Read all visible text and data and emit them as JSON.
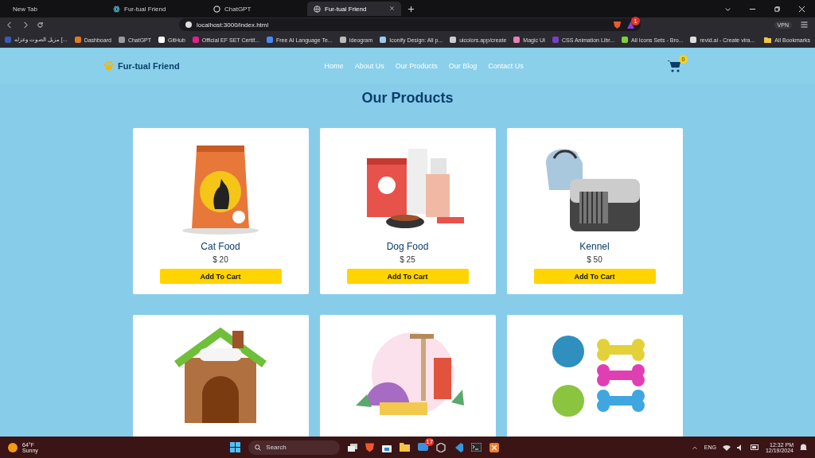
{
  "browser": {
    "tabs": [
      {
        "title": "New Tab",
        "selected": false
      },
      {
        "title": "Fur-tual Friend",
        "selected": false
      },
      {
        "title": "ChatGPT",
        "selected": false
      },
      {
        "title": "Fur-tual Friend",
        "selected": true
      }
    ],
    "address": "localhost:3000/index.html",
    "alert_count": "1",
    "vpn": "VPN",
    "bookmarks": [
      {
        "label": "مزيل الصوت وعزله [...",
        "color": "#3b5bb5"
      },
      {
        "label": "Dashboard",
        "color": "#e07a1f"
      },
      {
        "label": "ChatGPT",
        "color": "#9a9a9a"
      },
      {
        "label": "GitHub",
        "color": "#ffffff"
      },
      {
        "label": "Official EF SET Certif...",
        "color": "#e0218a"
      },
      {
        "label": "Free AI Language Te...",
        "color": "#4a8af4"
      },
      {
        "label": "Ideogram",
        "color": "#bbbbbb"
      },
      {
        "label": "Iconify Design: All p...",
        "color": "#9ec9ef"
      },
      {
        "label": "uicolors.app/create",
        "color": "#cccccc"
      },
      {
        "label": "Magic UI",
        "color": "#e87fb8"
      },
      {
        "label": "CSS Animation Libr...",
        "color": "#7a3fc2"
      },
      {
        "label": "All Icons Sets - Bro...",
        "color": "#7bd13b"
      },
      {
        "label": "revid.ai - Create vira...",
        "color": "#dddddd"
      }
    ],
    "all_bookmarks": "All Bookmarks"
  },
  "site": {
    "logo": "Fur-tual Friend",
    "nav": [
      {
        "label": "Home"
      },
      {
        "label": "About Us"
      },
      {
        "label": "Our Products"
      },
      {
        "label": "Our Blog"
      },
      {
        "label": "Contact Us"
      }
    ],
    "cart_count": "0",
    "heading": "Our Products",
    "products": [
      {
        "kind": "cat-food",
        "name": "Cat Food",
        "price": "$ 20",
        "button": "Add To Cart"
      },
      {
        "kind": "dog-food",
        "name": "Dog Food",
        "price": "$ 25",
        "button": "Add To Cart"
      },
      {
        "kind": "kennel",
        "name": "Kennel",
        "price": "$ 50",
        "button": "Add To Cart"
      },
      {
        "kind": "dog-house"
      },
      {
        "kind": "cat-care"
      },
      {
        "kind": "toys"
      }
    ]
  },
  "taskbar": {
    "temperature": "64°F",
    "weather": "Sunny",
    "search": "Search",
    "store_badge": "17",
    "language": "ENG",
    "time": "12:32 PM",
    "date": "12/19/2024"
  }
}
